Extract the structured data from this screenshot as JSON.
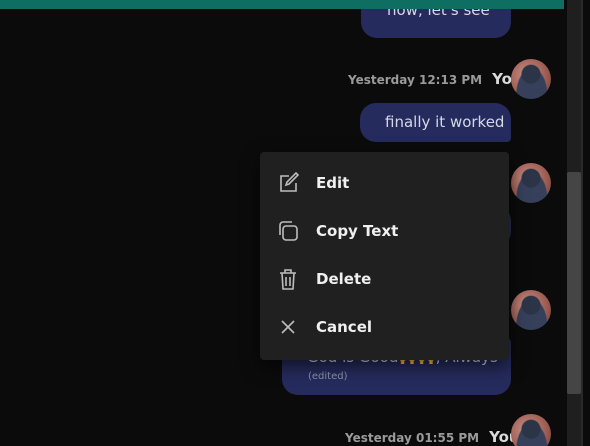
{
  "messages": [
    {
      "text": "now, let's see"
    },
    {
      "meta": {
        "time": "Yesterday 12:13 PM",
        "author": "You"
      },
      "text": "finally it worked"
    },
    {
      "text": ""
    },
    {
      "text": "God is Good🙌🙌, Always",
      "edited_label": "(edited)"
    },
    {
      "meta": {
        "time": "Yesterday 01:55 PM",
        "author": "You"
      }
    }
  ],
  "context_menu": {
    "items": [
      {
        "label": "Edit",
        "icon": "edit-icon"
      },
      {
        "label": "Copy Text",
        "icon": "copy-icon"
      },
      {
        "label": "Delete",
        "icon": "trash-icon"
      },
      {
        "label": "Cancel",
        "icon": "close-icon"
      }
    ]
  },
  "colors": {
    "top_bar": "#0e6e62",
    "bubble": "#252b5c",
    "menu_bg": "#202020",
    "background": "#0b0b0b"
  }
}
